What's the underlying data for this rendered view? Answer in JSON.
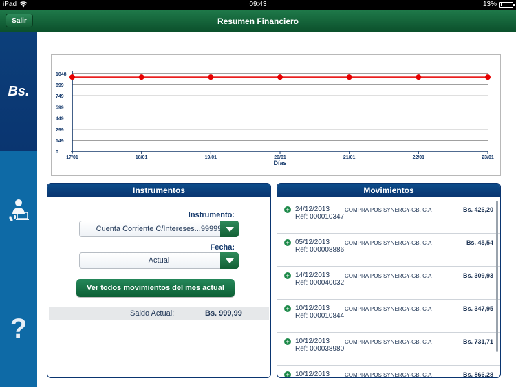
{
  "status": {
    "device": "iPad",
    "time": "09:43",
    "battery": "13%",
    "battery_level": 0.13
  },
  "nav": {
    "back_label": "Salir",
    "title": "Resumen Financiero"
  },
  "sidebar": {
    "bs_label": "Bs.",
    "help_label": "?"
  },
  "chart_data": {
    "type": "line",
    "x": [
      "17/01",
      "18/01",
      "19/01",
      "20/01",
      "21/01",
      "22/01",
      "23/01"
    ],
    "series": [
      {
        "values": [
          999.99,
          999.99,
          999.99,
          999.99,
          999.99,
          999.99,
          999.99
        ]
      }
    ],
    "yticks": [
      "0",
      "149",
      "299",
      "449",
      "599",
      "749",
      "899",
      "1048"
    ],
    "ytick_values": [
      0,
      149,
      299,
      449,
      599,
      749,
      899,
      1048
    ],
    "xlabel": "Días",
    "ylabel": "",
    "ylim": [
      0,
      1048
    ],
    "grid": true,
    "series_color": "#e60000"
  },
  "instrumentos": {
    "title": "Instrumentos",
    "instrumento_label": "Instrumento:",
    "instrumento_value": "Cuenta Corriente C/Intereses...99999",
    "fecha_label": "Fecha:",
    "fecha_value": "Actual",
    "ver_button": "Ver todos movimientos del mes actual",
    "saldo_label": "Saldo Actual:",
    "saldo_value": "Bs. 999,99"
  },
  "movimientos": {
    "title": "Movimientos",
    "items": [
      {
        "date": "24/12/2013",
        "ref": "Ref: 000010347",
        "desc": "COMPRA POS SYNERGY-GB, C.A",
        "amount": "Bs. 426,20"
      },
      {
        "date": "05/12/2013",
        "ref": "Ref: 000008886",
        "desc": "COMPRA POS SYNERGY-GB, C.A",
        "amount": "Bs. 45,54"
      },
      {
        "date": "14/12/2013",
        "ref": "Ref: 000040032",
        "desc": "COMPRA POS SYNERGY-GB, C.A",
        "amount": "Bs. 309,93"
      },
      {
        "date": "10/12/2013",
        "ref": "Ref: 000010844",
        "desc": "COMPRA POS SYNERGY-GB, C.A",
        "amount": "Bs. 347,95"
      },
      {
        "date": "10/12/2013",
        "ref": "Ref: 000038980",
        "desc": "COMPRA POS SYNERGY-GB, C.A",
        "amount": "Bs. 731,71"
      },
      {
        "date": "10/12/2013",
        "ref": "",
        "desc": "COMPRA POS SYNERGY-GB, C.A",
        "amount": "Bs. 866,28"
      }
    ]
  }
}
